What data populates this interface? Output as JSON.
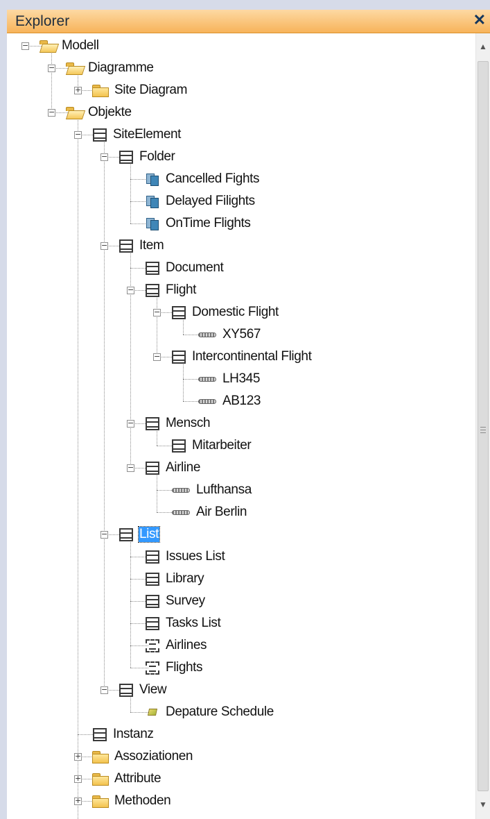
{
  "panel": {
    "title": "Explorer",
    "close_glyph": "✕"
  },
  "tree": [
    {
      "label": "Modell",
      "icon": "folder-open-icon"
    },
    {
      "label": "Diagramme",
      "icon": "folder-open-icon"
    },
    {
      "label": "Site Diagram",
      "icon": "folder-icon"
    },
    {
      "label": "Objekte",
      "icon": "folder-open-icon"
    },
    {
      "label": "SiteElement",
      "icon": "class-icon"
    },
    {
      "label": "Folder",
      "icon": "class-icon"
    },
    {
      "label": "Cancelled Fights",
      "icon": "form-icon"
    },
    {
      "label": "Delayed Filights",
      "icon": "form-icon"
    },
    {
      "label": "OnTime Flights",
      "icon": "form-icon"
    },
    {
      "label": "Item",
      "icon": "class-icon"
    },
    {
      "label": "Document",
      "icon": "class-icon"
    },
    {
      "label": "Flight",
      "icon": "class-icon"
    },
    {
      "label": "Domestic Flight",
      "icon": "class-icon"
    },
    {
      "label": "XY567",
      "icon": "instance-icon"
    },
    {
      "label": "Intercontinental Flight",
      "icon": "class-icon"
    },
    {
      "label": "LH345",
      "icon": "instance-icon"
    },
    {
      "label": "AB123",
      "icon": "instance-icon"
    },
    {
      "label": "Mensch",
      "icon": "class-icon"
    },
    {
      "label": "Mitarbeiter",
      "icon": "class-icon"
    },
    {
      "label": "Airline",
      "icon": "class-icon"
    },
    {
      "label": "Lufthansa",
      "icon": "instance-icon"
    },
    {
      "label": "Air Berlin",
      "icon": "instance-icon"
    },
    {
      "label": "List",
      "icon": "class-icon"
    },
    {
      "label": "Issues List",
      "icon": "class-icon"
    },
    {
      "label": "Library",
      "icon": "class-icon"
    },
    {
      "label": "Survey",
      "icon": "class-icon"
    },
    {
      "label": "Tasks List",
      "icon": "class-icon"
    },
    {
      "label": "Airlines",
      "icon": "list-icon"
    },
    {
      "label": "Flights",
      "icon": "list-icon"
    },
    {
      "label": "View",
      "icon": "class-icon"
    },
    {
      "label": "Depature Schedule",
      "icon": "view-icon"
    },
    {
      "label": "Instanz",
      "icon": "class-icon"
    },
    {
      "label": "Assoziationen",
      "icon": "folder-icon"
    },
    {
      "label": "Attribute",
      "icon": "folder-icon"
    },
    {
      "label": "Methoden",
      "icon": "folder-icon"
    }
  ],
  "selected_item": "List",
  "colors": {
    "titlebar": "#f7b35a",
    "selection": "#3399ff",
    "background": "#ffffff"
  }
}
